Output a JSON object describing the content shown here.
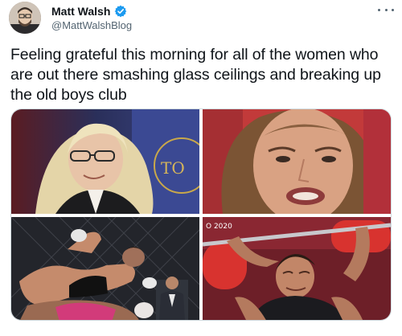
{
  "author": {
    "display_name": "Matt Walsh",
    "handle": "@MattWalshBlog",
    "verified": true,
    "avatar_icon": "user-avatar"
  },
  "tweet": {
    "text": "Feeling grateful this morning for all of the women who are out there smashing glass ceilings and breaking up the old boys club"
  },
  "media": [
    {
      "name": "photo-top-left",
      "visible_text": "TO"
    },
    {
      "name": "photo-top-right"
    },
    {
      "name": "photo-bottom-left"
    },
    {
      "name": "photo-bottom-right",
      "visible_text": "O 2020"
    }
  ],
  "colors": {
    "text_primary": "#0f1419",
    "text_secondary": "#536471",
    "verified_blue": "#1d9bf0",
    "border": "#cfd9de"
  },
  "icons": {
    "verified": "verified-badge-icon",
    "more": "more-options-icon"
  }
}
